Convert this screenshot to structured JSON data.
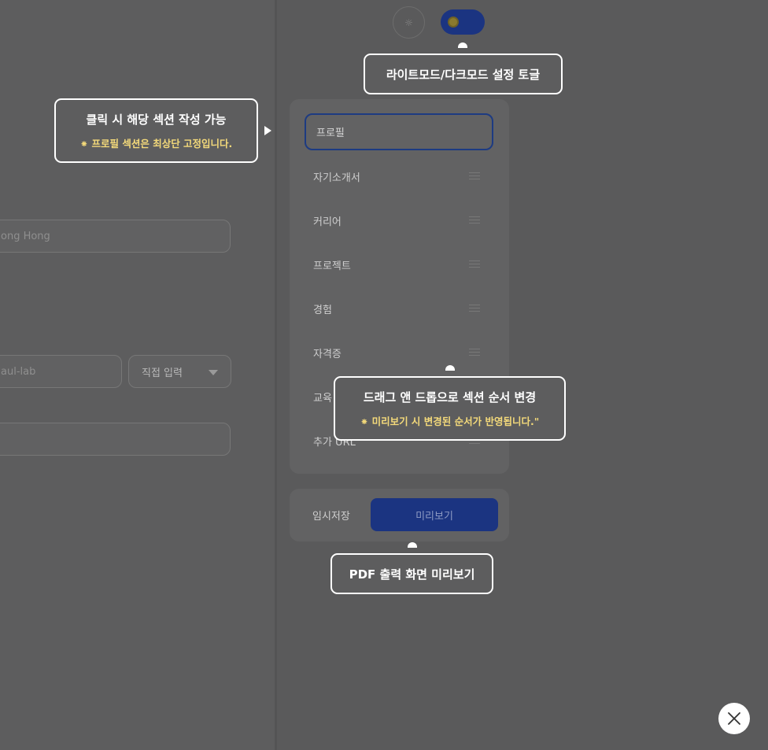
{
  "form": {
    "location_value": "ong Hong",
    "github_value": "aul-lab",
    "link_type_value": "직접 입력",
    "extra_value": ""
  },
  "sections": {
    "items": [
      {
        "label": "프로필"
      },
      {
        "label": "자기소개서"
      },
      {
        "label": "커리어"
      },
      {
        "label": "프로젝트"
      },
      {
        "label": "경험"
      },
      {
        "label": "자격증"
      },
      {
        "label": "교육"
      },
      {
        "label": "추가 URL"
      }
    ]
  },
  "actions": {
    "save_label": "임시저장",
    "preview_label": "미리보기"
  },
  "theme": {
    "dark_mode_on": true,
    "accent_color": "#1b3481",
    "note_color": "#f3d97a"
  },
  "tour": {
    "toggle_tip": "라이트모드/다크모드 설정 토글",
    "section_tip_title": "클릭 시 해당 섹션 작성 가능",
    "section_tip_note": "⁕ 프로필 섹션은 최상단 고정입니다.",
    "drag_tip_title": "드래그 앤 드롭으로 섹션 순서 변경",
    "drag_tip_note": "⁕ 미리보기 시 변경된 순서가 반영됩니다.\"",
    "preview_tip": "PDF 출력 화면 미리보기"
  }
}
